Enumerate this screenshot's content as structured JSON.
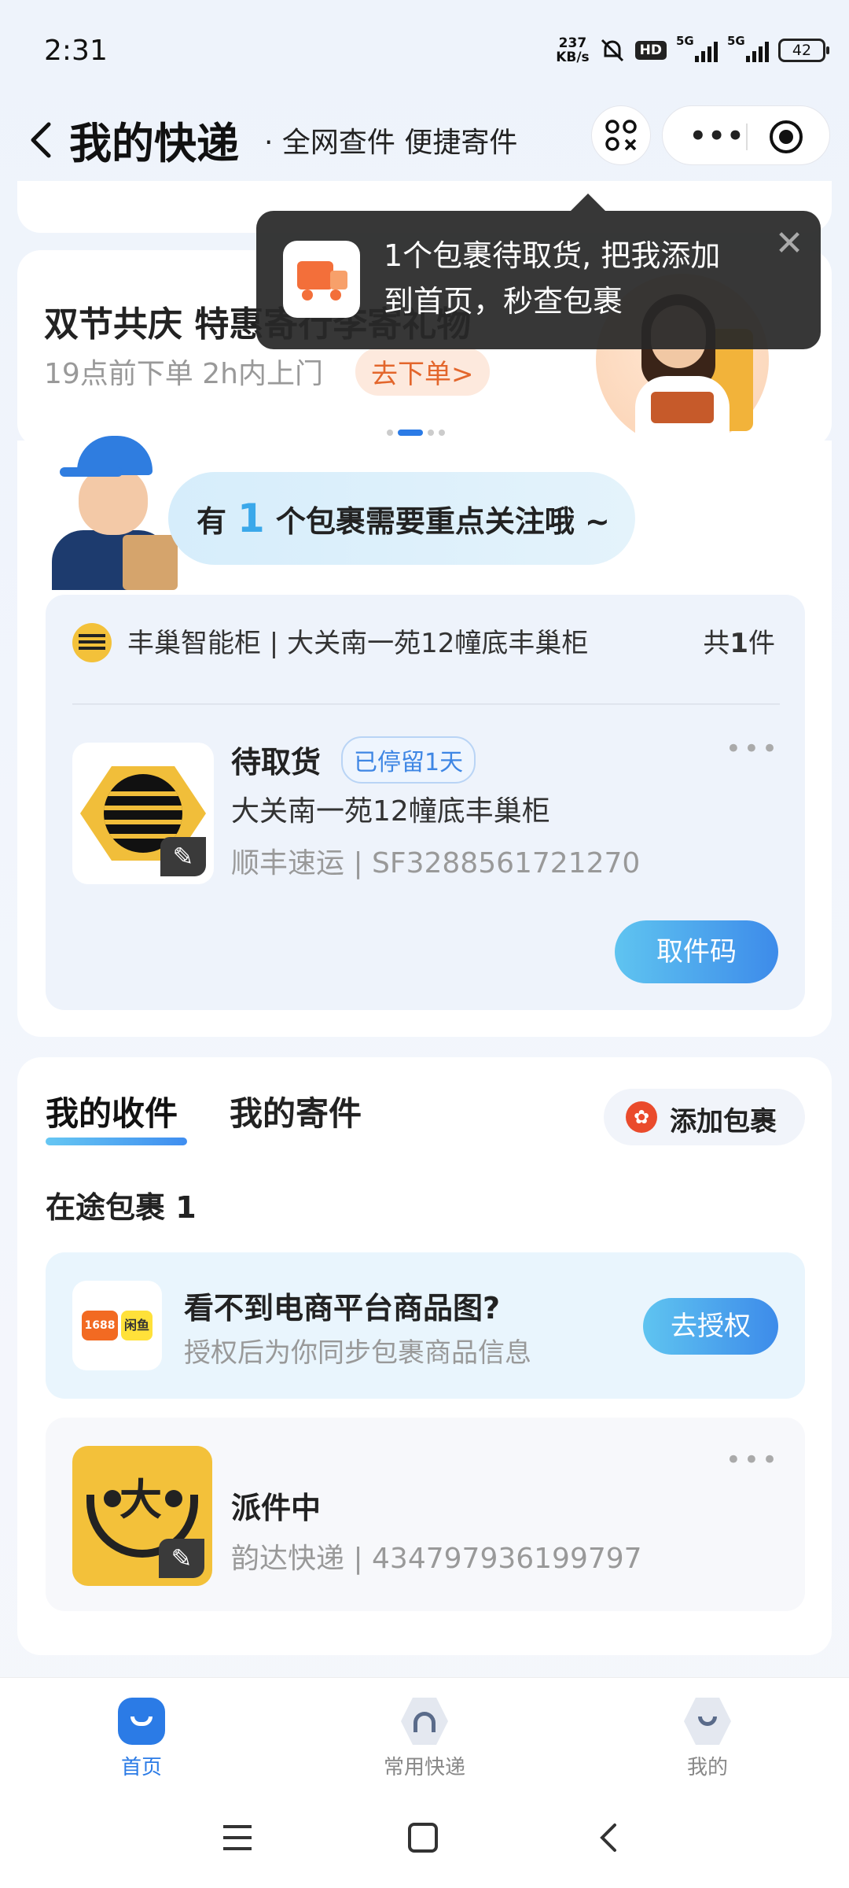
{
  "status_bar": {
    "time": "2:31",
    "net_speed_value": "237",
    "net_speed_unit": "KB/s",
    "hd_label": "HD",
    "sim1_label": "5G",
    "sim2_label": "5G",
    "battery": "42"
  },
  "header": {
    "title": "我的快递",
    "subtitle": "· 全网查件 便捷寄件",
    "more_label": "•••"
  },
  "toast": {
    "text": "1个包裹待取货, 把我添加到首页，秒查包裹",
    "close_label": "✕"
  },
  "promo": {
    "title": "双节共庆 特惠寄行李寄礼物",
    "subtitle": "19点前下单 2h内上门",
    "button": "去下单>"
  },
  "focus": {
    "prefix": "有",
    "count": "1",
    "suffix": "个包裹需要重点关注哦 ~"
  },
  "locker_card": {
    "locker_name": "丰巢智能柜 | 大关南一苑12幢底丰巢柜",
    "count_prefix": "共",
    "count": "1",
    "count_suffix": "件",
    "package": {
      "status": "待取货",
      "tag": "已停留1天",
      "address": "大关南一苑12幢底丰巢柜",
      "courier_no": "顺丰速运 | SF3288561721270",
      "more": "•••",
      "pickup_button": "取件码"
    }
  },
  "receive": {
    "tab_receive": "我的收件",
    "tab_send": "我的寄件",
    "add_button": "添加包裹",
    "transit_label": "在途包裹 1",
    "auth_card": {
      "logo_left": "1688",
      "logo_right": "闲鱼",
      "title": "看不到电商平台商品图?",
      "subtitle": "授权后为你同步包裹商品信息",
      "button": "去授权"
    },
    "yunda": {
      "status": "派件中",
      "courier_no": "韵达快递 | 434797936199797",
      "more": "•••"
    }
  },
  "bottom_nav": {
    "items": [
      {
        "label": "首页",
        "active": true
      },
      {
        "label": "常用快递",
        "active": false
      },
      {
        "label": "我的",
        "active": false
      }
    ]
  },
  "colors": {
    "accent": "#2b7be6",
    "promo_orange": "#e3662c",
    "locker_yellow": "#f1be3a"
  }
}
